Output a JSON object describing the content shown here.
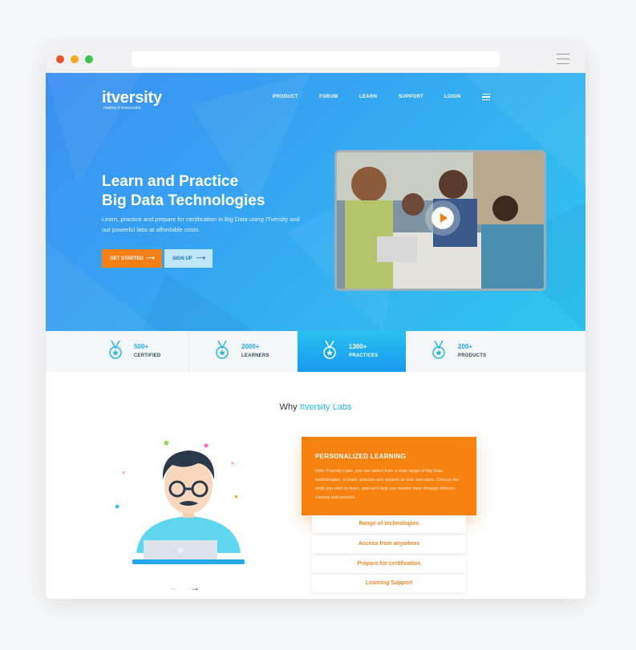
{
  "brand": {
    "logo_text": "itversity",
    "tagline": "making it resourceful"
  },
  "nav": {
    "items": [
      "PRODUCT",
      "FORUM",
      "LEARN",
      "SUPPORT",
      "LOGIN"
    ],
    "menu_icon": "hamburger-icon"
  },
  "hero": {
    "title_line1": "Learn and Practice",
    "title_line2": "Big Data Technologies",
    "subtitle": "Learn, practice and prepare for certification in Big Data using ITversity and our powerful labs at affordable costs.",
    "cta_primary": "GET STARTED",
    "cta_secondary": "SIGN UP",
    "video_icon": "play-icon"
  },
  "stats": [
    {
      "value": "500+",
      "label": "CERTIFIED"
    },
    {
      "value": "2000+",
      "label": "LEARNERS"
    },
    {
      "value": "1300+",
      "label": "PRACTICES"
    },
    {
      "value": "200+",
      "label": "PRODUCTS"
    }
  ],
  "why": {
    "prefix": "Why",
    "accent": "Itversity Labs"
  },
  "card": {
    "title": "PERSONALIZED LEARNING",
    "body": "With ITversity Labs, you can select from a wide range of Big Data technologies, to learn, practise and explore at your own pace. Choose the skills you wish to learn, and we'll help you master them through efficient training and practice."
  },
  "features": [
    "Range of technologies",
    "Access from anywhere",
    "Prepare for certification",
    "Learning Support"
  ],
  "carousel": {
    "prev": "←",
    "next": "→"
  },
  "colors": {
    "accent_orange": "#f47f17",
    "accent_blue": "#25b6ea",
    "hero_gradient_start": "#3b8ff0",
    "hero_gradient_end": "#2fc7ef"
  }
}
